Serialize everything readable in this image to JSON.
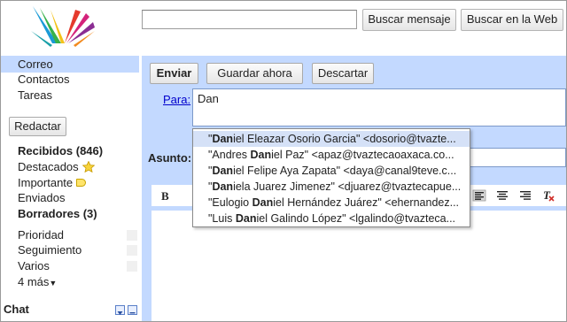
{
  "header": {
    "search_placeholder": "",
    "search_mail_label": "Buscar mensaje",
    "search_web_label": "Buscar en la Web"
  },
  "nav": {
    "items": [
      {
        "label": "Correo"
      },
      {
        "label": "Contactos"
      },
      {
        "label": "Tareas"
      }
    ],
    "compose_label": "Redactar",
    "folders": [
      {
        "label": "Recibidos (846)"
      },
      {
        "label": "Destacados"
      },
      {
        "label": "Importante"
      },
      {
        "label": "Enviados"
      },
      {
        "label": "Borradores (3)"
      }
    ],
    "labels": [
      {
        "label": "Prioridad"
      },
      {
        "label": "Seguimiento"
      },
      {
        "label": "Varios"
      },
      {
        "label": "4 más"
      }
    ],
    "chat_label": "Chat"
  },
  "compose": {
    "send_label": "Enviar",
    "save_label": "Guardar ahora",
    "discard_label": "Descartar",
    "to_label": "Para:",
    "to_value": "Dan",
    "subject_label": "Asunto:",
    "bold_label": "B"
  },
  "autocomplete": {
    "selected_index": 0,
    "items": [
      {
        "pre": "\"",
        "match": "Dan",
        "post": "iel Eleazar Osorio Garcia\" <dosorio@tvazte..."
      },
      {
        "pre": "\"Andres ",
        "match": "Dan",
        "post": "iel Paz\" <apaz@tvaztecaoaxaca.co..."
      },
      {
        "pre": "\"",
        "match": "Dan",
        "post": "iel Felipe Aya Zapata\" <daya@canal9teve.c..."
      },
      {
        "pre": "\"",
        "match": "Dan",
        "post": "iela Juarez Jimenez\" <djuarez@tvaztecapue..."
      },
      {
        "pre": "\"Eulogio ",
        "match": "Dan",
        "post": "iel Hernández Juárez\" <ehernandez..."
      },
      {
        "pre": "\"Luis ",
        "match": "Dan",
        "post": "iel Galindo López\" <lgalindo@tvazteca..."
      }
    ]
  }
}
